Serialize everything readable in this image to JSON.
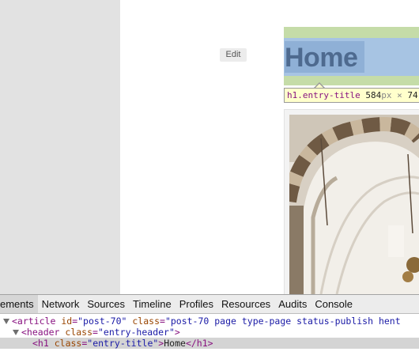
{
  "page": {
    "edit_label": "Edit",
    "entry_title": "Home"
  },
  "inspector_tooltip": {
    "selector": "h1.entry-title",
    "width": "584",
    "unit": "px",
    "times": "×",
    "height_partial": "74"
  },
  "devtools": {
    "tabs": [
      "ements",
      "Network",
      "Sources",
      "Timeline",
      "Profiles",
      "Resources",
      "Audits",
      "Console"
    ],
    "active_tab": 0,
    "lines": {
      "article_open": "<article",
      "article_id_attr": "id",
      "article_id_val": "\"post-70\"",
      "article_class_attr": "class",
      "article_class_val": "\"post-70 page type-page status-publish hent",
      "header_open": "<header",
      "header_class_attr": "class",
      "header_class_val": "\"entry-header\"",
      "header_close": ">",
      "h1_open": "<h1",
      "h1_class_attr": "class",
      "h1_class_val": "\"entry-title\"",
      "h1_gt": ">",
      "h1_text": "Home",
      "h1_close": "</h1>"
    }
  },
  "colors": {
    "highlight_margin": "#c5dca8",
    "highlight_content": "#a7c4e3",
    "tag": "#881280",
    "attr": "#994500",
    "value": "#1a1aa6"
  }
}
